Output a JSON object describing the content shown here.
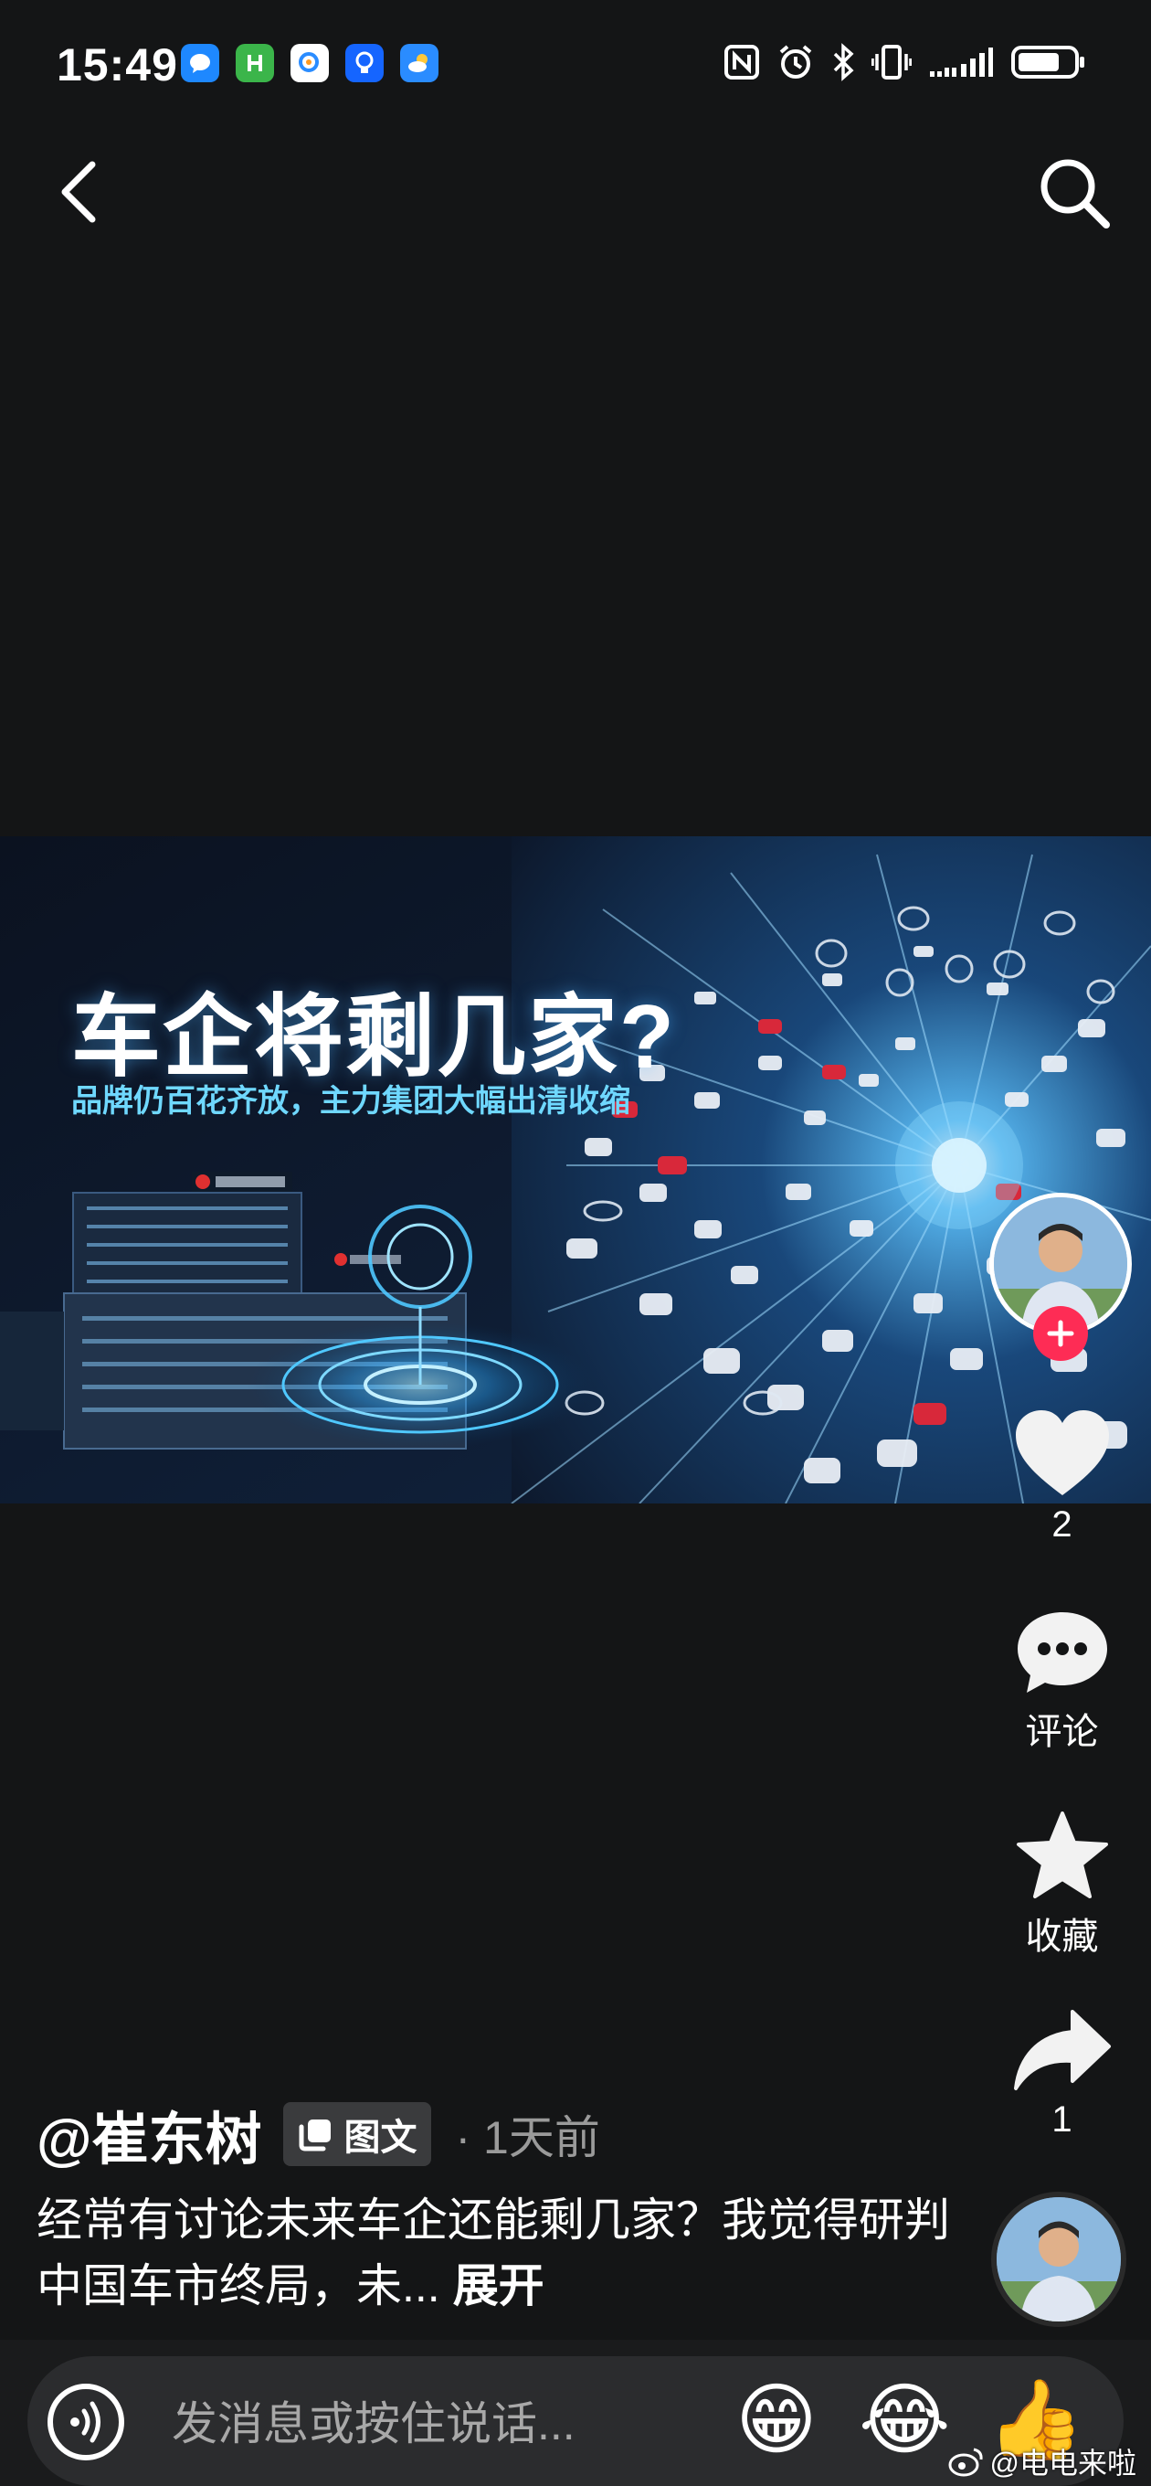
{
  "status_bar": {
    "time": "15:49",
    "notification_icons": [
      {
        "name": "message-app-icon",
        "color": "#1e88ff"
      },
      {
        "name": "green-app-icon",
        "color": "#3bb54a"
      },
      {
        "name": "search-app-icon",
        "color": "#ffffff"
      },
      {
        "name": "lightbulb-app-icon",
        "color": "#1565ff"
      },
      {
        "name": "weather-app-icon",
        "color": "#2a8cff"
      }
    ],
    "system_icons": [
      "nfc-icon",
      "alarm-icon",
      "bluetooth-icon",
      "vibrate-icon",
      "signal-icon",
      "battery-icon"
    ],
    "battery_level": 0.75
  },
  "post": {
    "image": {
      "title": "车企将剩几家?",
      "subtitle": "品牌仍百花齐放，主力集团大幅出清收缩"
    },
    "author": "@崔东树",
    "type_badge": "图文",
    "time": "· 1天前",
    "caption": "经常有讨论未来车企还能剩几家？我觉得研判中国车市终局，未...",
    "expand_label": "展开"
  },
  "actions": {
    "likes": "2",
    "comment_label": "评论",
    "favorite_label": "收藏",
    "shares": "1"
  },
  "bottom_bar": {
    "placeholder": "发消息或按住说话...",
    "emojis": [
      "😁",
      "😂",
      "👍"
    ]
  },
  "watermark": "@电电来啦",
  "colors": {
    "background": "#141516",
    "accent": "#fe2c55",
    "muted_text": "#9a9a9a"
  }
}
